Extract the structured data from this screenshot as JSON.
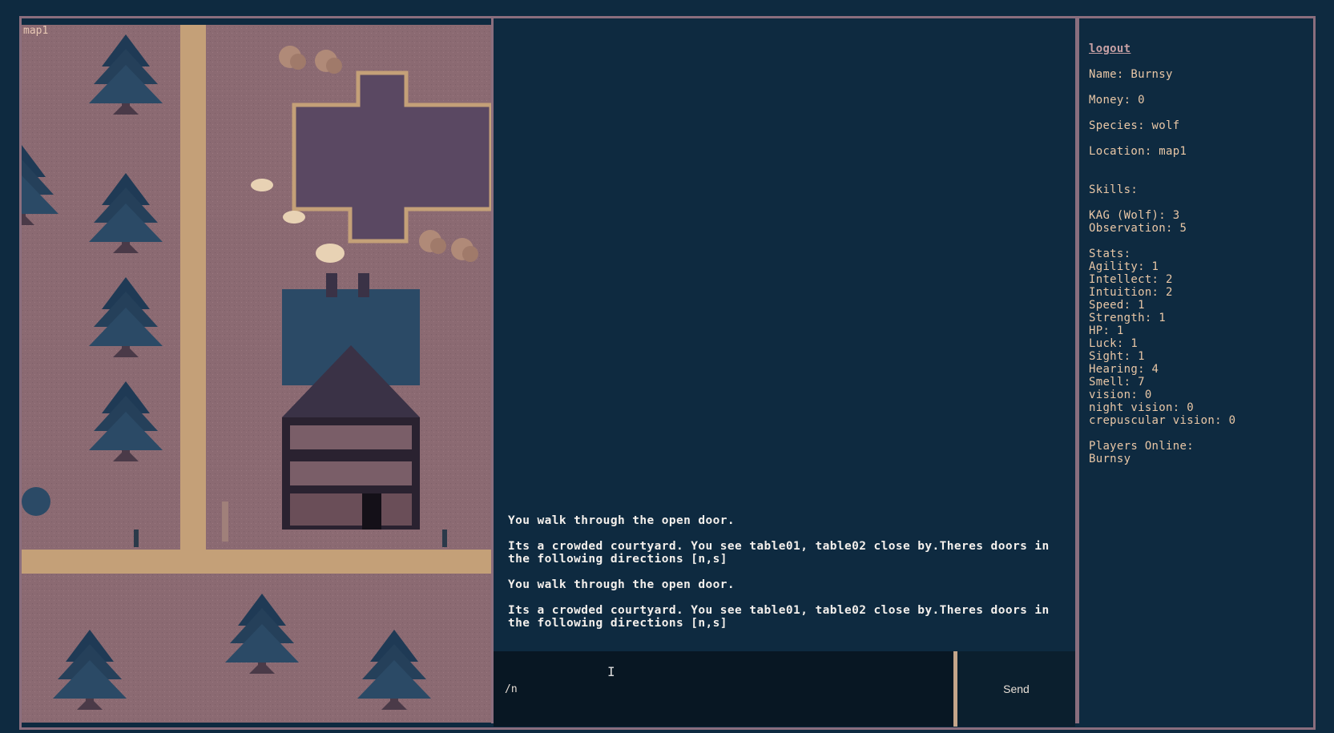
{
  "map": {
    "label": "map1"
  },
  "chat": {
    "messages": [
      "You walk through the open door.",
      "Its a crowded courtyard. You see table01, table02 close by.Theres doors in\nthe following directions [n,s]",
      "You walk through the open door.",
      "Its a crowded courtyard. You see table01, table02 close by.Theres doors in\nthe following directions [n,s]"
    ],
    "input_value": "/n",
    "send_label": "Send"
  },
  "sidebar": {
    "logout_label": "logout",
    "name": "Name: Burnsy",
    "money": "Money: 0",
    "species": "Species: wolf",
    "location": "Location: map1",
    "skills_heading": "Skills:",
    "skills": [
      "KAG (Wolf): 3",
      "Observation: 5"
    ],
    "stats_heading": "Stats:",
    "stats": [
      "Agility: 1",
      "Intellect: 2",
      "Intuition: 2",
      "Speed: 1",
      "Strength: 1",
      "HP: 1",
      "Luck: 1",
      "Sight: 1",
      "Hearing: 4",
      "Smell: 7",
      "vision: 0",
      "night vision: 0",
      "crepuscular vision: 0"
    ],
    "players_heading": "Players Online:",
    "players": [
      "Burnsy"
    ]
  },
  "colors": {
    "background": "#0e2a40",
    "frame": "#8a6e7e",
    "ground": "#8b6a72",
    "path": "#c4a078",
    "tree": "#25405a",
    "text": "#e9c7a6"
  }
}
